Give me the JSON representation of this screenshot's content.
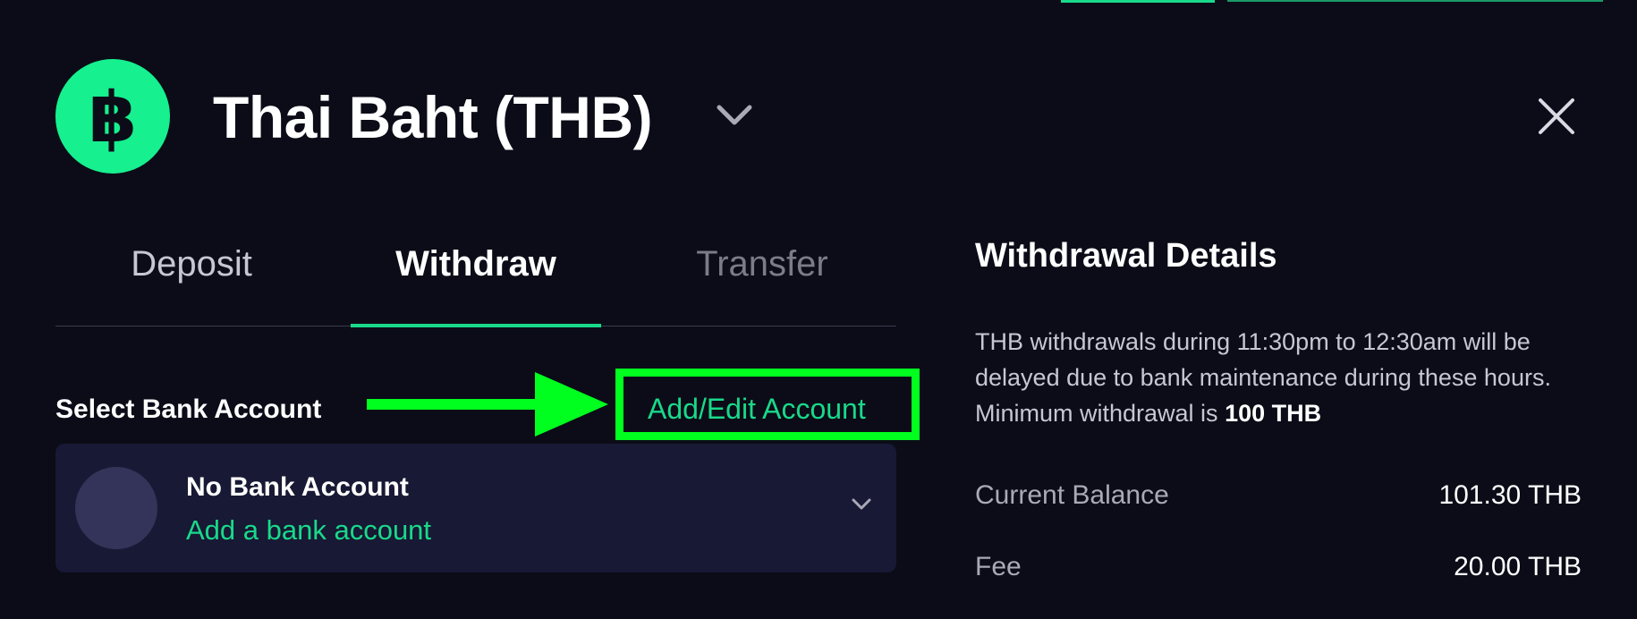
{
  "header": {
    "title": "Thai Baht (THB)",
    "coin_symbol": "฿",
    "coin_icon": "baht-coin-icon",
    "accent_color": "#16f08f"
  },
  "tabs": [
    {
      "label": "Deposit",
      "active": false
    },
    {
      "label": "Withdraw",
      "active": true
    },
    {
      "label": "Transfer",
      "active": false
    }
  ],
  "bank_section": {
    "label": "Select Bank Account",
    "add_edit_label": "Add/Edit Account",
    "highlight_color": "#00ff1e",
    "selected": {
      "name": "No Bank Account",
      "action": "Add a bank account"
    }
  },
  "details": {
    "title": "Withdrawal Details",
    "description_prefix": "THB withdrawals during 11:30pm to 12:30am will be delayed due to bank maintenance during these hours. Minimum withdrawal is ",
    "description_bold": "100 THB",
    "rows": [
      {
        "label": "Current Balance",
        "value": "101.30 THB"
      },
      {
        "label": "Fee",
        "value": "20.00 THB"
      }
    ]
  }
}
